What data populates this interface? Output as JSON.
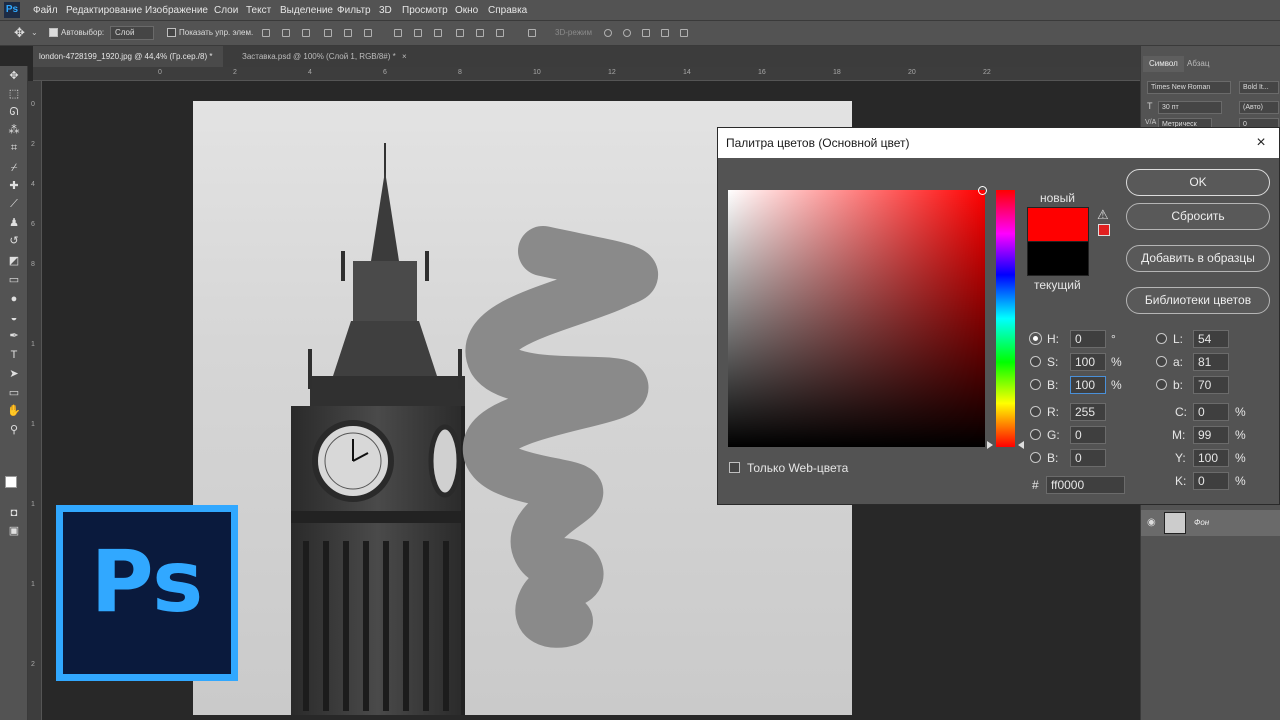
{
  "app": {
    "logo": "Ps"
  },
  "menu": [
    "Файл",
    "Редактирование",
    "Изображение",
    "Слои",
    "Текст",
    "Выделение",
    "Фильтр",
    "3D",
    "Просмотр",
    "Окно",
    "Справка"
  ],
  "options": {
    "autoselect_label": "Автовыбор:",
    "autoselect_value": "Слой",
    "show_controls": "Показать упр. элем.",
    "mode3d": "3D-режим"
  },
  "tabs": [
    {
      "label": "london-4728199_1920.jpg @ 44,4% (Гр.сер./8) *",
      "close": "×"
    },
    {
      "label": "Заставка.psd @ 100% (Слой 1, RGB/8#) *",
      "close": "×"
    }
  ],
  "ruler": {
    "top": [
      "0",
      "2",
      "4",
      "6",
      "8",
      "10",
      "12",
      "14",
      "16",
      "18",
      "20",
      "22"
    ],
    "left": [
      "0",
      "2",
      "4",
      "6",
      "8",
      "1",
      "2",
      "1",
      "4",
      "1",
      "6",
      "1",
      "8",
      "2",
      "0",
      "2",
      "2",
      "2",
      "4",
      "2"
    ]
  },
  "char_panel": {
    "tab_active": "Символ",
    "tab_other": "Абзац",
    "font": "Times New Roman",
    "style": "Bold It...",
    "size": "30 пт",
    "leading": "(Авто)",
    "kerning": "Метрическ",
    "tracking": "0",
    "size_icon": "T",
    "kern_icon": "V/A"
  },
  "layers": {
    "name": "Фон"
  },
  "dialog": {
    "title": "Палитра цветов (Основной цвет)",
    "close": "×",
    "new_label": "новый",
    "current_label": "текущий",
    "new_color": "#ff0000",
    "current_color": "#000000",
    "buttons": {
      "ok": "OK",
      "reset": "Сбросить",
      "add_swatch": "Добавить в образцы",
      "libraries": "Библиотеки цветов"
    },
    "web_only": "Только Web-цвета",
    "hsb": [
      {
        "label": "H:",
        "value": "0",
        "unit": "°",
        "selected": true
      },
      {
        "label": "S:",
        "value": "100",
        "unit": "%",
        "selected": false
      },
      {
        "label": "B:",
        "value": "100",
        "unit": "%",
        "selected": false
      }
    ],
    "rgb": [
      {
        "label": "R:",
        "value": "255"
      },
      {
        "label": "G:",
        "value": "0"
      },
      {
        "label": "B:",
        "value": "0"
      }
    ],
    "lab": [
      {
        "label": "L:",
        "value": "54"
      },
      {
        "label": "a:",
        "value": "81"
      },
      {
        "label": "b:",
        "value": "70"
      }
    ],
    "cmyk": [
      {
        "label": "C:",
        "value": "0",
        "unit": "%"
      },
      {
        "label": "M:",
        "value": "99",
        "unit": "%"
      },
      {
        "label": "Y:",
        "value": "100",
        "unit": "%"
      },
      {
        "label": "K:",
        "value": "0",
        "unit": "%"
      }
    ],
    "hex_label": "#",
    "hex": "ff0000",
    "warning_icon": "⚠"
  },
  "badge": {
    "text": "Ps",
    "bg": "#0a1a3d",
    "accent": "#31a8ff"
  }
}
